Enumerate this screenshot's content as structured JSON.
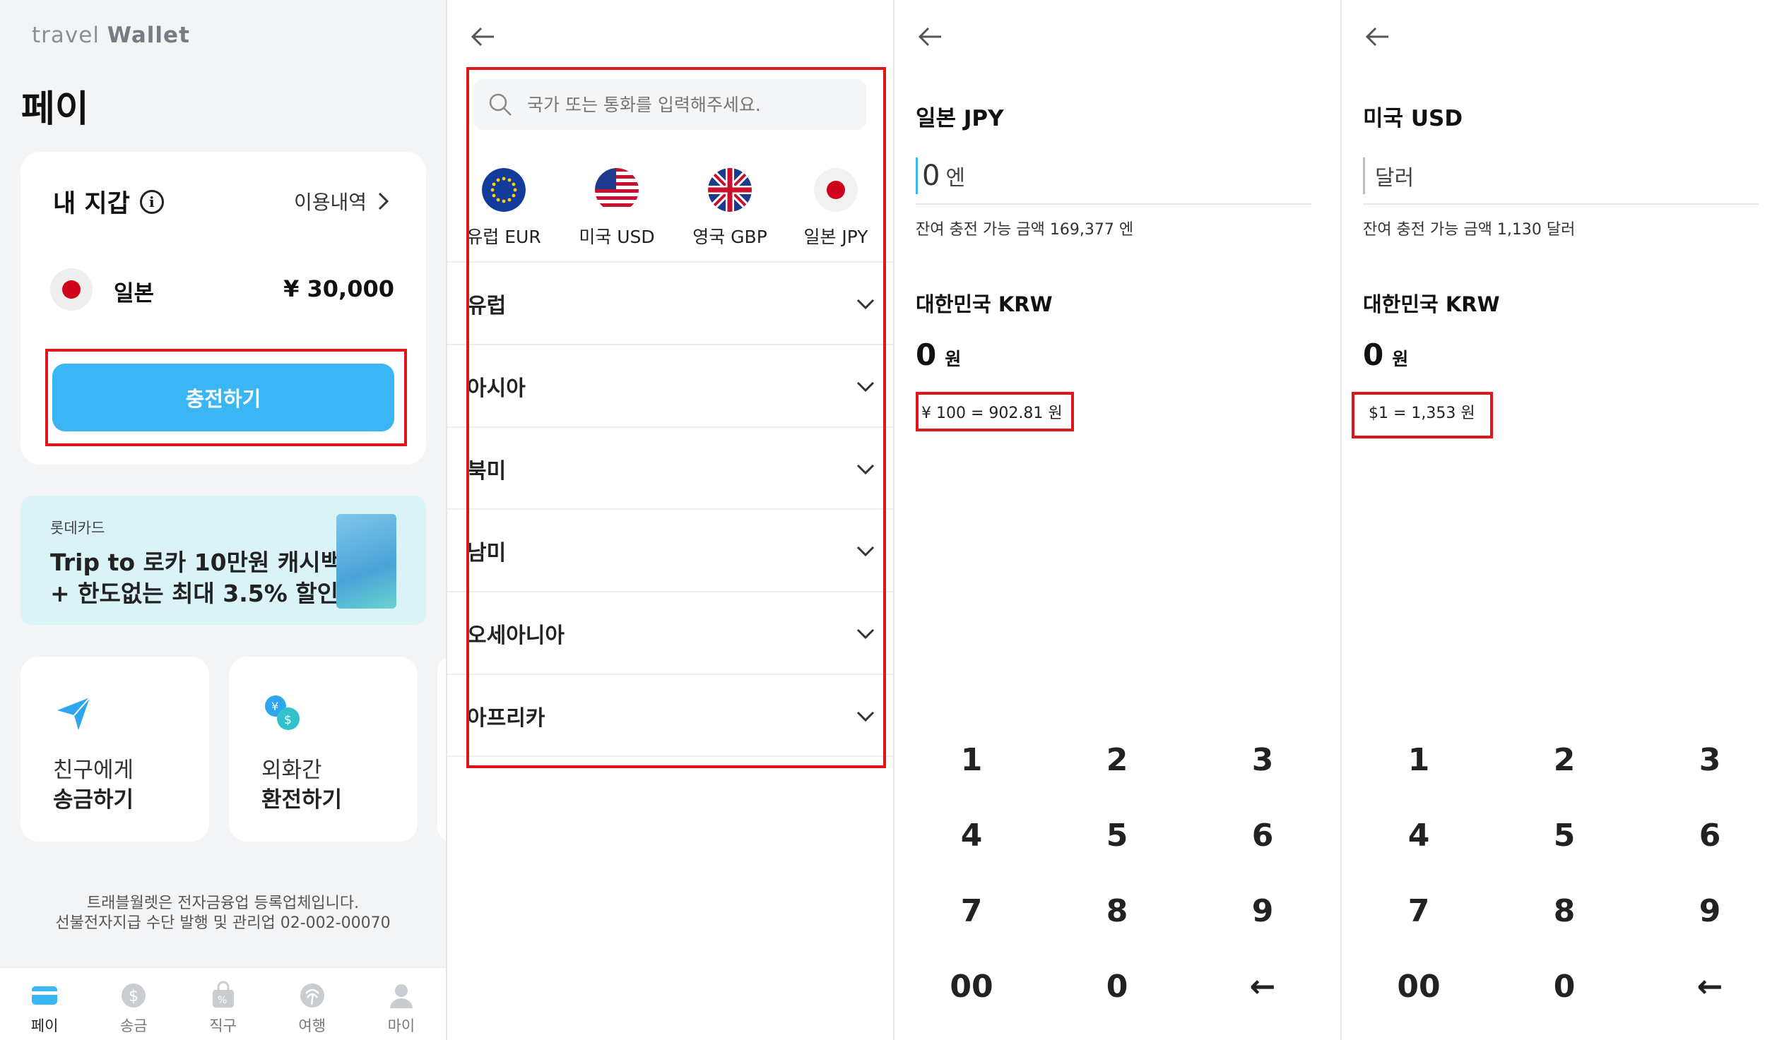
{
  "panel1": {
    "logo_prefix": "travel",
    "logo_brand": "Wallet",
    "page_title": "페이",
    "wallet": {
      "title": "내 지갑",
      "history_link": "이용내역",
      "country": "일본",
      "balance": "¥ 30,000",
      "charge_label": "충전하기"
    },
    "banner": {
      "sponsor": "롯데카드",
      "line1": "Trip to 로카 10만원 캐시백!",
      "line2": "+ 한도없는 최대 3.5% 할인"
    },
    "tiles": [
      {
        "line1": "친구에게",
        "line2": "송금하기",
        "icon": "send-icon"
      },
      {
        "line1": "외화간",
        "line2": "환전하기",
        "icon": "exchange-icon"
      }
    ],
    "legal_1": "트래블월렛은 전자금융업 등록업체입니다.",
    "legal_2": "선불전자지급 수단 발행 및 관리업 02-002-00070",
    "tabs": [
      {
        "label": "페이",
        "icon": "pay-card-icon"
      },
      {
        "label": "송금",
        "icon": "dollar-coin-icon"
      },
      {
        "label": "직구",
        "icon": "shopping-bag-icon"
      },
      {
        "label": "여행",
        "icon": "palm-tree-icon"
      },
      {
        "label": "마이",
        "icon": "person-icon"
      }
    ],
    "accent": "#3ab6f5"
  },
  "panel2": {
    "search_placeholder": "국가 또는 통화를 입력해주세요.",
    "favorites": [
      {
        "label": "유럽 EUR",
        "icon": "eu-flag-icon"
      },
      {
        "label": "미국 USD",
        "icon": "us-flag-icon"
      },
      {
        "label": "영국 GBP",
        "icon": "uk-flag-icon"
      },
      {
        "label": "일본 JPY",
        "icon": "japan-flag-icon"
      }
    ],
    "regions": [
      "유럽",
      "아시아",
      "북미",
      "남미",
      "오세아니아",
      "아프리카"
    ]
  },
  "panel3": {
    "currency": "일본 JPY",
    "amount": "0",
    "unit": "엔",
    "limit_text": "잔여 충전 가능 금액 169,377 엔",
    "krw_label": "대한민국 KRW",
    "krw_amount": "0",
    "krw_unit": "원",
    "rate": "¥ 100 = 902.81 원"
  },
  "panel4": {
    "currency": "미국 USD",
    "amount": "",
    "unit": "달러",
    "limit_text": "잔여 충전 가능 금액 1,130 달러",
    "krw_label": "대한민국 KRW",
    "krw_amount": "0",
    "krw_unit": "원",
    "rate": "$1 = 1,353 원"
  },
  "keypad": [
    "1",
    "2",
    "3",
    "4",
    "5",
    "6",
    "7",
    "8",
    "9",
    "00",
    "0",
    "←"
  ]
}
